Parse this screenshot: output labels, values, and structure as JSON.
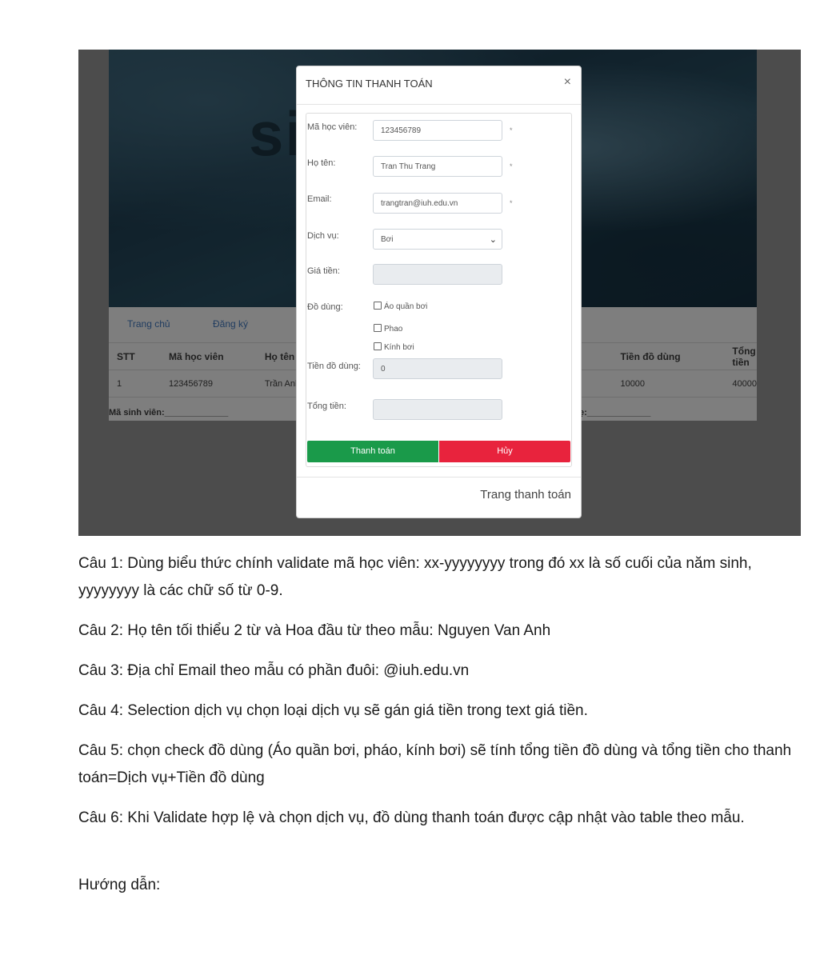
{
  "screenshot": {
    "hero_text": "si",
    "nav": [
      "Trang chủ",
      "Đăng ký"
    ],
    "table": {
      "headers": [
        "STT",
        "Mã học viên",
        "Họ tên",
        "",
        "",
        "Tiền đồ dùng",
        "Tổng tiền"
      ],
      "row": [
        "1",
        "123456789",
        "Trần Anh",
        "",
        "",
        "10000",
        "40000"
      ]
    },
    "signature_left": "Mã sinh viên:_____________",
    "signature_right": "ẹ:_____________"
  },
  "modal": {
    "title": "THÔNG TIN THANH TOÁN",
    "close": "×",
    "fields": {
      "ma_hoc_vien": {
        "label": "Mã học viên:",
        "value": "123456789",
        "required": "*"
      },
      "ho_ten": {
        "label": "Họ tên:",
        "value": "Tran Thu Trang",
        "required": "*"
      },
      "email": {
        "label": "Email:",
        "value": "trangtran@iuh.edu.vn",
        "required": "*"
      },
      "dich_vu": {
        "label": "Dịch vụ:",
        "value": "Bơi"
      },
      "gia_tien": {
        "label": "Giá tiền:",
        "value": ""
      },
      "do_dung": {
        "label": "Đồ dùng:",
        "options": [
          "Áo quần bơi",
          "Phao",
          "Kính bơi"
        ]
      },
      "tien_do_dung": {
        "label": "Tiền đồ dùng:",
        "value": "0"
      },
      "tong_tien": {
        "label": "Tổng tiền:",
        "value": ""
      }
    },
    "pay_button": "Thanh toán",
    "cancel_button": "Hủy",
    "footer": "Trang thanh toán"
  },
  "document": {
    "paragraphs": [
      "Câu 1: Dùng biểu thức chính validate mã học viên: xx-yyyyyyyy trong đó xx là số cuối của năm sinh, yyyyyyyy là các chữ số từ 0-9.",
      "Câu 2: Họ tên tối thiểu 2 từ và Hoa đầu từ theo mẫu: Nguyen Van Anh",
      "Câu 3: Địa chỉ Email theo mẫu có phần đuôi: @iuh.edu.vn",
      "Câu 4: Selection dịch vụ chọn loại dịch vụ sẽ gán giá tiền trong text giá tiền.",
      "Câu 5: chọn check đồ dùng (Áo quần bơi, pháo, kính bơi) sẽ tính tổng tiền đồ dùng và tổng tiền cho thanh toán=Dịch vụ+Tiền đồ dùng",
      "Câu 6: Khi Validate hợp lệ và chọn dịch vụ, đồ dùng thanh toán được cập nhật vào table theo mẫu.",
      "Hướng dẫn:"
    ]
  }
}
